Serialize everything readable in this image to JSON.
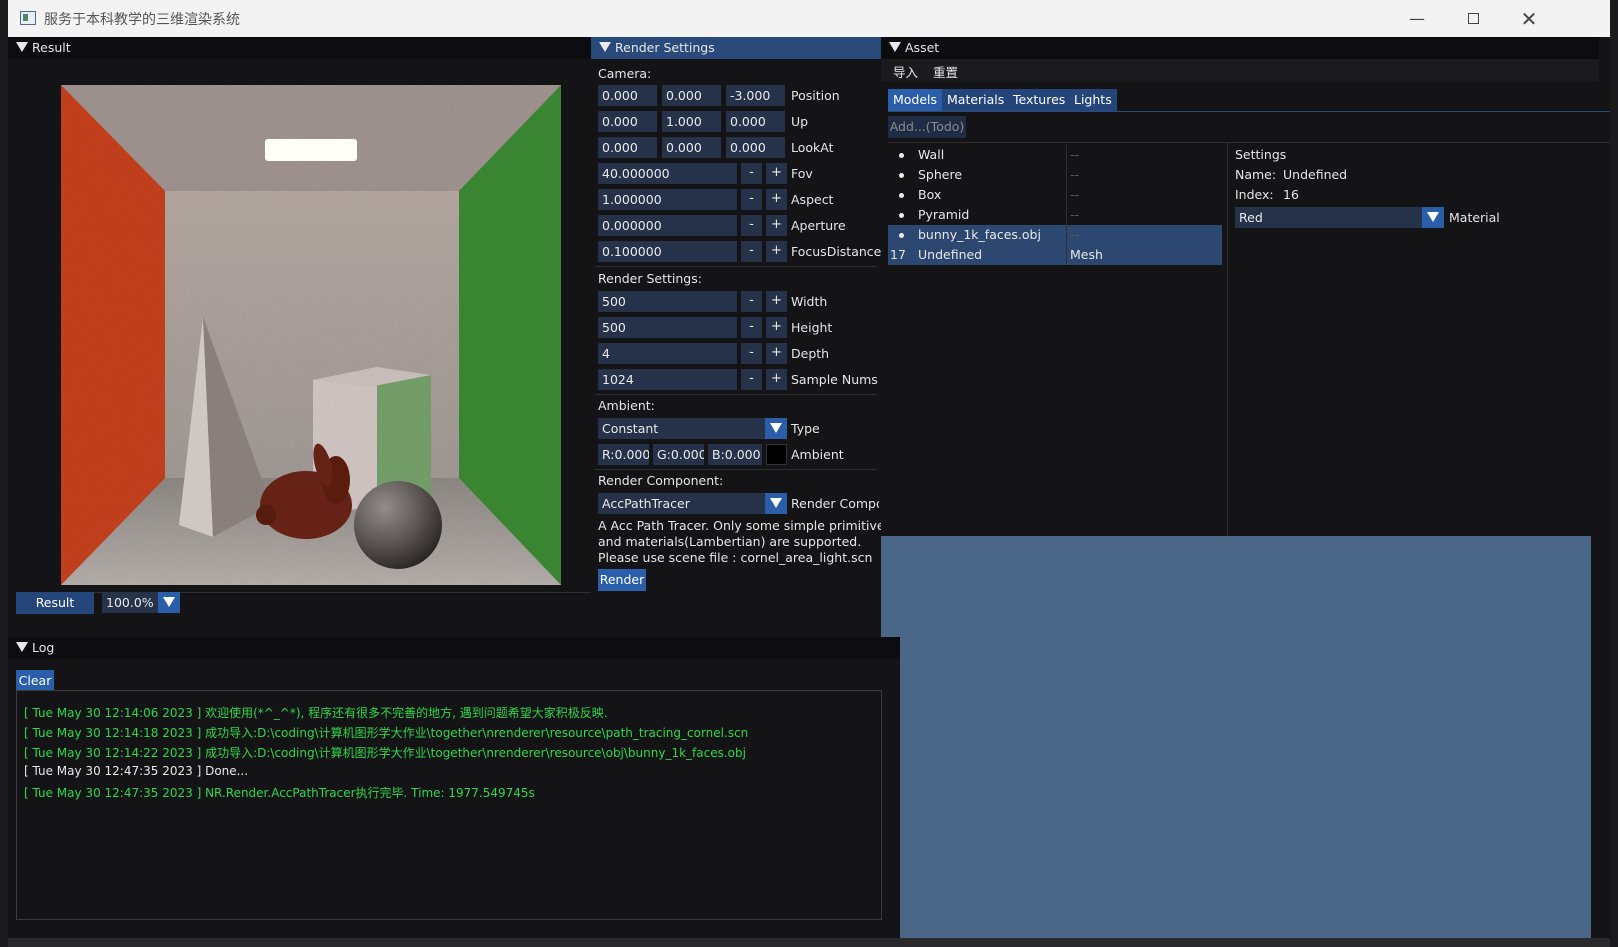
{
  "window": {
    "title": "服务于本科教学的三维渲染系统"
  },
  "result": {
    "header": "Result",
    "result_button": "Result",
    "zoom": "100.0%"
  },
  "settings": {
    "header": "Render Settings",
    "camera_label": "Camera:",
    "position": {
      "x": "0.000",
      "y": "0.000",
      "z": "-3.000",
      "label": "Position"
    },
    "up": {
      "x": "0.000",
      "y": "1.000",
      "z": "0.000",
      "label": "Up"
    },
    "lookat": {
      "x": "0.000",
      "y": "0.000",
      "z": "0.000",
      "label": "LookAt"
    },
    "fov": {
      "value": "40.000000",
      "label": "Fov"
    },
    "aspect": {
      "value": "1.000000",
      "label": "Aspect"
    },
    "aperture": {
      "value": "0.000000",
      "label": "Aperture"
    },
    "focus": {
      "value": "0.100000",
      "label": "FocusDistance"
    },
    "render_label": "Render Settings:",
    "width": {
      "value": "500",
      "label": "Width"
    },
    "height": {
      "value": "500",
      "label": "Height"
    },
    "depth": {
      "value": "4",
      "label": "Depth"
    },
    "samples": {
      "value": "1024",
      "label": "Sample Nums"
    },
    "ambient_label": "Ambient:",
    "ambient_type": {
      "value": "Constant",
      "label": "Type"
    },
    "ambient_color": {
      "r": "R:0.000",
      "g": "G:0.000",
      "b": "B:0.000",
      "label": "Ambient",
      "swatch": "#000000"
    },
    "component_label": "Render Component:",
    "component": {
      "value": "AccPathTracer",
      "label": "Render Compo"
    },
    "description": [
      "A Acc Path Tracer. Only some simple primitives",
      "and materials(Lambertian) are supported.",
      "Please use scene file : cornel_area_light.scn"
    ],
    "render_button": "Render",
    "minus": "-",
    "plus": "+"
  },
  "asset": {
    "header": "Asset",
    "menu": [
      "导入",
      "重置"
    ],
    "tabs": [
      "Models",
      "Materials",
      "Textures",
      "Lights"
    ],
    "add_button": "Add...(Todo)",
    "models": [
      {
        "name": "Wall",
        "type": "--"
      },
      {
        "name": "Sphere",
        "type": "--"
      },
      {
        "name": "Box",
        "type": "--"
      },
      {
        "name": "Pyramid",
        "type": "--"
      },
      {
        "name": "bunny_1k_faces.obj",
        "type": "--"
      },
      {
        "index": "17",
        "name": "Undefined",
        "type": "Mesh"
      }
    ],
    "settings": {
      "title": "Settings",
      "name_label": "Name:",
      "name_value": "Undefined",
      "index_label": "Index:",
      "index_value": "16",
      "material_value": "Red",
      "material_label": "Material"
    }
  },
  "log": {
    "header": "Log",
    "clear_button": "Clear",
    "lines": [
      {
        "text": "[ Tue May 30 12:14:06 2023 ] 欢迎使用(*^_^*), 程序还有很多不完善的地方, 遇到问题希望大家积极反映.",
        "color": "#2fd84a"
      },
      {
        "text": "[ Tue May 30 12:14:18 2023 ] 成功导入:D:\\coding\\计算机图形学大作业\\together\\nrenderer\\resource\\path_tracing_cornel.scn",
        "color": "#2fd84a"
      },
      {
        "text": "[ Tue May 30 12:14:22 2023 ] 成功导入:D:\\coding\\计算机图形学大作业\\together\\nrenderer\\resource\\obj\\bunny_1k_faces.obj",
        "color": "#2fd84a"
      },
      {
        "text": "[ Tue May 30 12:47:35 2023 ] Done...",
        "color": "#e8e8e8"
      },
      {
        "text": "[ Tue May 30 12:47:35 2023 ] NR.Render.AccPathTracer执行完毕. Time: 1977.549745s",
        "color": "#2fd84a"
      }
    ]
  }
}
